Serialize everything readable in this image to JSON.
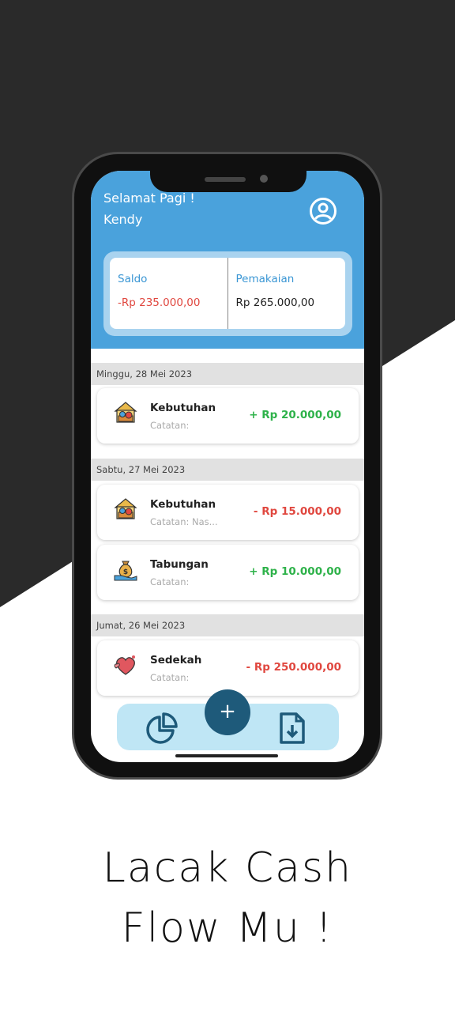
{
  "header": {
    "greeting": "Selamat Pagi !",
    "username": "Kendy",
    "profile_icon": "user-circle-icon"
  },
  "summary": {
    "saldo_label": "Saldo",
    "saldo_value": "-Rp 235.000,00",
    "usage_label": "Pemakaian",
    "usage_value": "Rp 265.000,00"
  },
  "groups": [
    {
      "date": "Minggu, 28 Mei 2023",
      "items": [
        {
          "title": "Kebutuhan",
          "note": "Catatan:",
          "amount": "+ Rp 20.000,00",
          "icon": "house-icon"
        }
      ]
    },
    {
      "date": "Sabtu, 27 Mei 2023",
      "items": [
        {
          "title": "Kebutuhan",
          "note": "Catatan: Nas...",
          "amount": "- Rp 15.000,00",
          "icon": "house-icon"
        },
        {
          "title": "Tabungan",
          "note": "Catatan:",
          "amount": "+ Rp 10.000,00",
          "icon": "money-bag-icon"
        }
      ]
    },
    {
      "date": "Jumat, 26 Mei 2023",
      "items": [
        {
          "title": "Sedekah",
          "note": "Catatan:",
          "amount": "- Rp 250.000,00",
          "icon": "heart-icon"
        }
      ]
    }
  ],
  "nav": {
    "fab_label": "+",
    "chart_icon": "pie-chart-icon",
    "export_icon": "download-file-icon"
  },
  "tagline": {
    "line1": "Lacak Cash",
    "line2": "Flow Mu !"
  },
  "colors": {
    "header": "#4aa2dc",
    "positive": "#2eb24a",
    "negative": "#e0473f",
    "fab": "#1e5a7a",
    "nav": "#bfe6f5"
  }
}
